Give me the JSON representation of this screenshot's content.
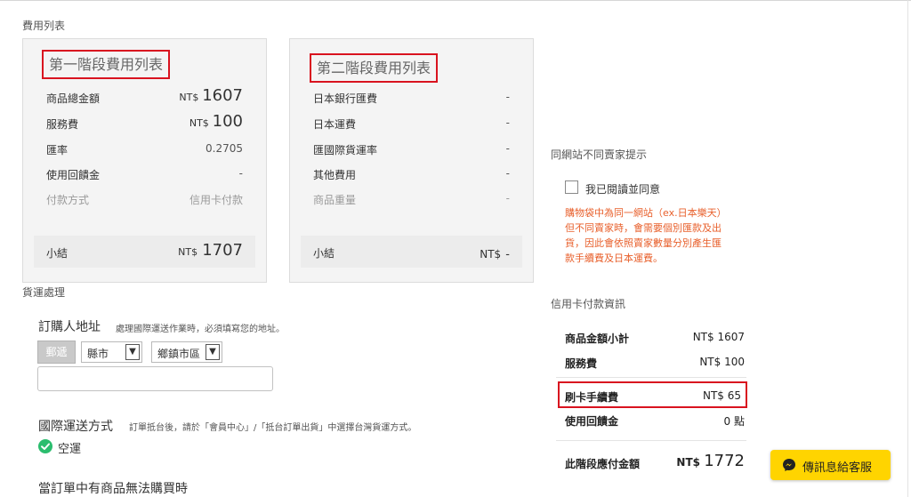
{
  "fee_list": {
    "section_label": "費用列表"
  },
  "stage1": {
    "title": "第一階段費用列表",
    "rows": [
      {
        "label": "商品總金額",
        "currency": "NT$",
        "amount": "1607"
      },
      {
        "label": "服務費",
        "currency": "NT$",
        "amount": "100"
      },
      {
        "label": "匯率",
        "value": "0.2705"
      },
      {
        "label": "使用回饋金",
        "value": "-"
      },
      {
        "label": "付款方式",
        "value": "信用卡付款"
      }
    ],
    "subtotal": {
      "label": "小結",
      "currency": "NT$",
      "amount": "1707"
    }
  },
  "stage2": {
    "title": "第二階段費用列表",
    "rows": [
      {
        "label": "日本銀行匯費",
        "value": "-"
      },
      {
        "label": "日本運費",
        "value": "-"
      },
      {
        "label": "匯國際貨運率",
        "value": "-"
      },
      {
        "label": "其他費用",
        "value": "-"
      },
      {
        "label": "商品重量",
        "value": "-"
      }
    ],
    "subtotal": {
      "label": "小結",
      "currency": "NT$",
      "amount": "-"
    }
  },
  "seller_notice": {
    "heading": "同網站不同賣家提示",
    "checkbox_label": "我已閱讀並同意",
    "warning_lines": [
      "購物袋中為同一網站（ex.日本樂天）",
      "但不同賣家時，會需要個別匯款及出",
      "貨，因此會依照賣家數量分別產生匯",
      "款手續費及日本運費。"
    ]
  },
  "shipping": {
    "section_label": "貨運處理",
    "address": {
      "title": "訂購人地址",
      "hint": "處理國際運送作業時，必須填寫您的地址。",
      "zip_button": "郵遞",
      "county_select": "縣市",
      "township_select": "鄉鎮市區",
      "detail_value": ""
    },
    "intl": {
      "title": "國際運送方式",
      "hint": "訂單抵台後，請於「會員中心」/「抵台訂單出貨」中選擇台灣貨運方式。",
      "method": "空運"
    },
    "unavailable_title": "當訂單中有商品無法購買時"
  },
  "credit_card": {
    "section_label": "信用卡付款資訊",
    "rows": [
      {
        "label": "商品金額小計",
        "value": "NT$ 1607"
      },
      {
        "label": "服務費",
        "value": "NT$ 100"
      },
      {
        "label": "刷卡手續費",
        "value": "NT$ 65"
      },
      {
        "label": "使用回饋金",
        "value": "0 點"
      }
    ],
    "total": {
      "label": "此階段應付金額",
      "currency": "NT$",
      "amount": "1772"
    }
  },
  "chat_button": {
    "label": "傳訊息給客服",
    "icon": "messenger-icon"
  },
  "colors": {
    "highlight_red": "#d9131f",
    "warning_orange": "#e8602c",
    "chat_yellow": "#ffd400",
    "check_green": "#2bbd6e"
  }
}
